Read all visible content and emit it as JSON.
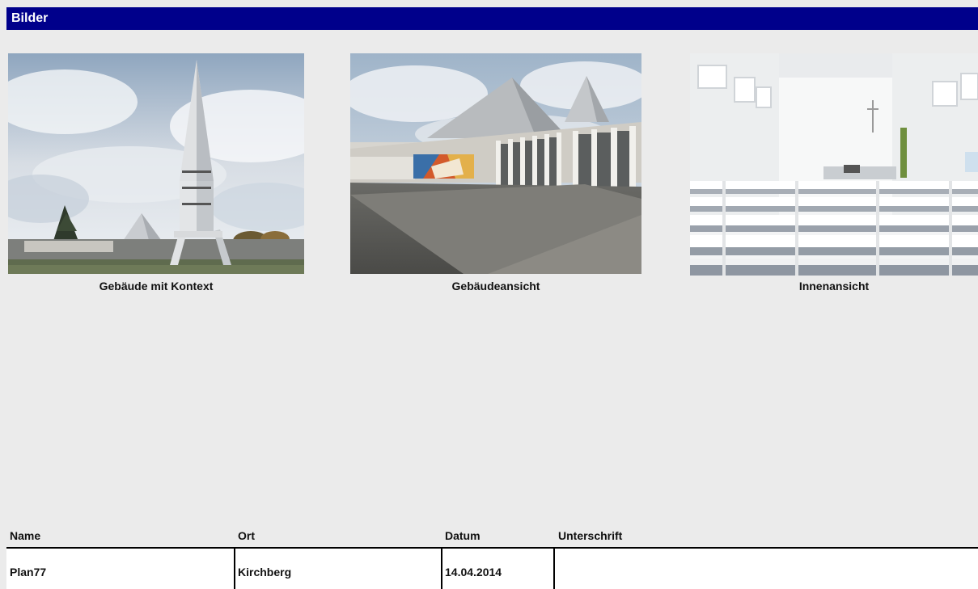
{
  "header": {
    "title": "Bilder"
  },
  "photos": [
    {
      "caption": "Gebäude mit Kontext"
    },
    {
      "caption": "Gebäudeansicht"
    },
    {
      "caption": "Innenansicht"
    }
  ],
  "form": {
    "labels": {
      "name": "Name",
      "ort": "Ort",
      "datum": "Datum",
      "unterschrift": "Unterschrift"
    },
    "values": {
      "name": "Plan77",
      "ort": "Kirchberg",
      "datum": "14.04.2014",
      "unterschrift": ""
    }
  }
}
